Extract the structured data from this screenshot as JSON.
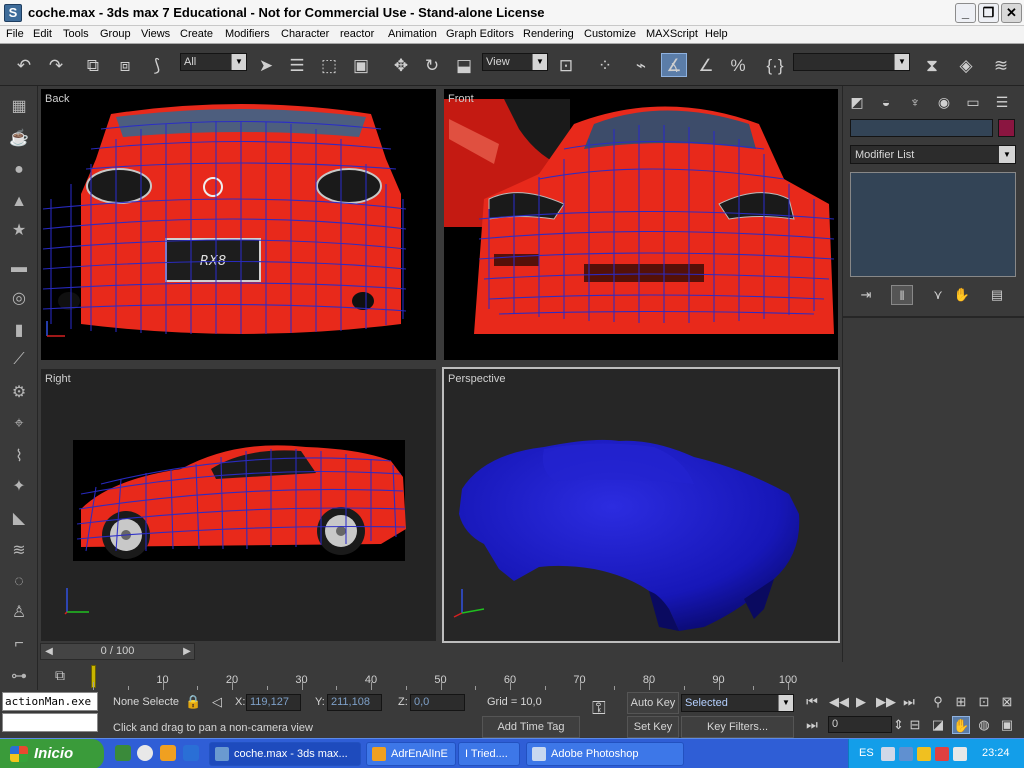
{
  "window": {
    "title": "coche.max - 3ds max 7  Educational - Not for Commercial Use - Stand-alone License",
    "app_icon": "3ds-max-logo-icon",
    "minimize_glyph": "_",
    "maximize_glyph": "❐",
    "close_glyph": "✕"
  },
  "menu": [
    "File",
    "Edit",
    "Tools",
    "Group",
    "Views",
    "Create",
    "Modifiers",
    "Character",
    "reactor",
    "Animation",
    "Graph Editors",
    "Rendering",
    "Customize",
    "MAXScript",
    "Help"
  ],
  "toolbar": {
    "selection_filter": "All",
    "reference_coord": "View",
    "named_selection": "",
    "icons": [
      "undo-icon",
      "redo-icon",
      "link-icon",
      "unlink-icon",
      "bind-spacewarp-icon",
      "select-object-icon",
      "select-by-name-icon",
      "rect-selection-region-icon",
      "window-crossing-icon",
      "select-move-icon",
      "select-rotate-icon",
      "select-scale-icon",
      "use-pivot-icon",
      "select-manipulate-icon",
      "keyboard-shortcut-icon",
      "snap-3d-icon",
      "angle-snap-icon",
      "percent-snap-icon",
      "spinner-snap-icon",
      "edit-named-selection-icon",
      "mirror-icon",
      "align-icon",
      "layer-manager-icon"
    ]
  },
  "left_tools": [
    "box-icon",
    "teapot-icon",
    "sphere-icon",
    "cone-icon",
    "star-icon",
    "plane-icon",
    "torus-icon",
    "cylinder-icon",
    "tube-icon",
    "helper-icon",
    "gear-icon",
    "bone-icon",
    "light-icon",
    "camera-icon",
    "wave-icon",
    "spacewarp-icon",
    "biped-icon",
    "particle-icon",
    "bend-icon",
    "morph-icon"
  ],
  "viewports": {
    "back": {
      "label": "Back"
    },
    "front": {
      "label": "Front"
    },
    "right": {
      "label": "Right"
    },
    "perspective": {
      "label": "Perspective"
    },
    "axis_x_color": "#d42020",
    "axis_y_color": "#20c020",
    "axis_z_color": "#3050e0",
    "wire_color": "#2a2cc8",
    "car_color": "#e8291b",
    "model_color": "#1717b8"
  },
  "command_panel": {
    "tabs": [
      "create-tab-icon",
      "modify-tab-icon",
      "hierarchy-tab-icon",
      "motion-tab-icon",
      "display-tab-icon",
      "utilities-tab-icon"
    ],
    "object_name": "",
    "object_color": "#8a1540",
    "modifier_list": "Modifier List",
    "stack_buttons": [
      "pin-stack-icon",
      "show-end-result-icon",
      "make-unique-icon",
      "remove-modifier-icon",
      "configure-modifier-sets-icon"
    ]
  },
  "time": {
    "frame_readout": "0 / 100",
    "ticks": [
      "10",
      "20",
      "30",
      "40",
      "50",
      "60",
      "70",
      "80",
      "90",
      "100"
    ]
  },
  "status": {
    "maxscript_listener": "actionMan.exe",
    "selection": "None Selecte",
    "x_label": "X:",
    "x_value": "119,127",
    "y_label": "Y:",
    "y_value": "211,108",
    "z_label": "Z:",
    "z_value": "0,0",
    "grid": "Grid = 10,0",
    "prompt": "Click and drag to pan a non-camera view",
    "add_time_tag": "Add Time Tag",
    "auto_key": "Auto Key",
    "set_key": "Set Key",
    "key_mode": "Selected",
    "key_filters": "Key Filters...",
    "current_frame": "0"
  },
  "taskbar": {
    "start": "Inicio",
    "tasks": [
      {
        "label": "coche.max - 3ds max...",
        "icon": "3ds-max-task-icon"
      },
      {
        "label": "AdrEnAlInE",
        "icon": "messenger-task-icon"
      },
      {
        "label": "I Tried....",
        "icon": "messenger-task-icon"
      },
      {
        "label": "Adobe Photoshop",
        "icon": "photoshop-task-icon"
      }
    ],
    "language": "ES",
    "clock": "23:24"
  }
}
